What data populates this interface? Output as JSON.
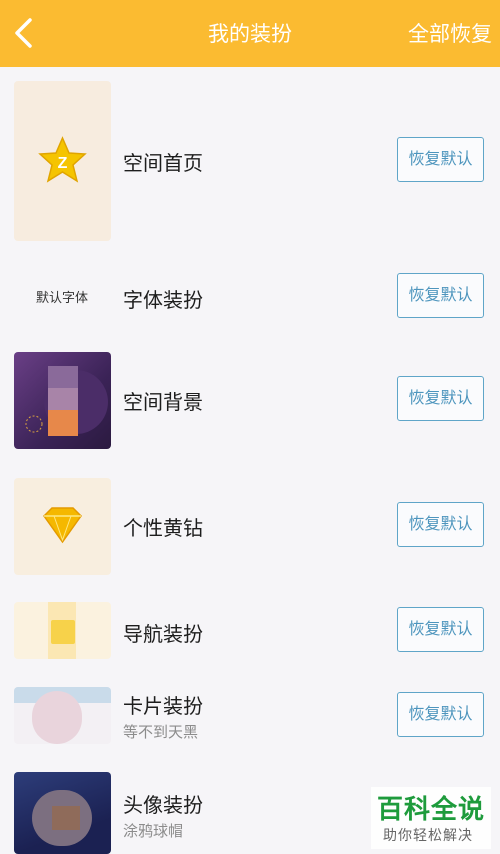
{
  "header": {
    "title": "我的装扮",
    "restore_all": "全部恢复"
  },
  "items": [
    {
      "label": "空间首页",
      "button": "恢复默认"
    },
    {
      "label": "字体装扮",
      "button": "恢复默认",
      "thumb_text": "默认字体"
    },
    {
      "label": "空间背景",
      "button": "恢复默认"
    },
    {
      "label": "个性黄钻",
      "button": "恢复默认"
    },
    {
      "label": "导航装扮",
      "button": "恢复默认"
    },
    {
      "label": "卡片装扮",
      "sub": "等不到天黑",
      "button": "恢复默认"
    },
    {
      "label": "头像装扮",
      "sub": "涂鸦球帽"
    }
  ],
  "watermark": {
    "big": "百科全说",
    "small": "助你轻松解决"
  },
  "colors": {
    "header": "#fbbb31",
    "button_border": "#5fa5c8",
    "button_text": "#4d95bd"
  }
}
